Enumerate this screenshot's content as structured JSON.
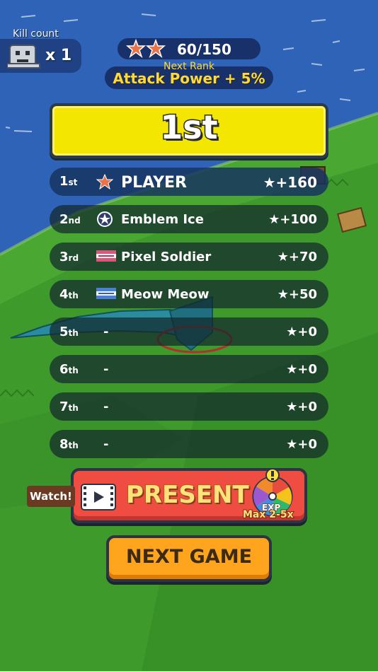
{
  "hud": {
    "kill_label": "Kill count",
    "kill_value": "x 1",
    "rank_stars": 2,
    "rank_progress": "60/150",
    "next_rank_label": "Next Rank",
    "next_rank_bonus": "Attack Power + 5%"
  },
  "result": {
    "place": "1st"
  },
  "leaderboard": [
    {
      "pos": "1",
      "suffix": "st",
      "icon": "star-icon",
      "name": "PLAYER",
      "score": "★+160",
      "is_player": true
    },
    {
      "pos": "2",
      "suffix": "nd",
      "icon": "emblem-star-icon",
      "name": "Emblem Ice",
      "score": "★+100"
    },
    {
      "pos": "3",
      "suffix": "rd",
      "icon": "flag-icon",
      "name": "Pixel Soldier",
      "score": "★+70"
    },
    {
      "pos": "4",
      "suffix": "th",
      "icon": "flag-icon",
      "name": "Meow Meow",
      "score": "★+50"
    },
    {
      "pos": "5",
      "suffix": "th",
      "icon": "",
      "name": "-",
      "score": "★+0"
    },
    {
      "pos": "6",
      "suffix": "th",
      "icon": "",
      "name": "-",
      "score": "★+0"
    },
    {
      "pos": "7",
      "suffix": "th",
      "icon": "",
      "name": "-",
      "score": "★+0"
    },
    {
      "pos": "8",
      "suffix": "th",
      "icon": "",
      "name": "-",
      "score": "★+0"
    }
  ],
  "buttons": {
    "watch_label": "Watch!",
    "present_label": "PRESENT",
    "exp_label": "EXP",
    "max_label": "Max 2-5x",
    "next_game_label": "NEXT GAME"
  },
  "colors": {
    "banner_yellow": "#f3e600",
    "present_red": "#ef4c42",
    "next_orange": "#ffa41d",
    "gold_text": "#ffd93b"
  }
}
